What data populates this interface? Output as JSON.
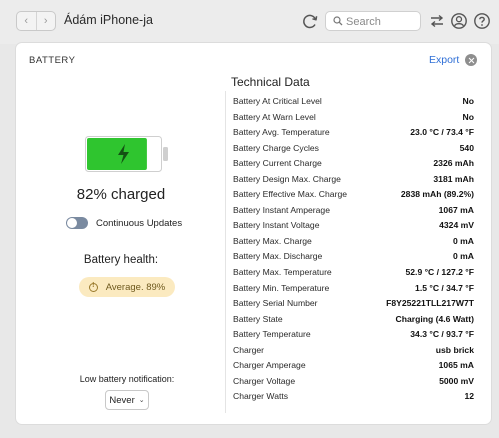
{
  "toolbar": {
    "device_name": "Ádám iPhone-ja",
    "back_glyph": "‹",
    "forward_glyph": "›",
    "search_placeholder": "Search",
    "icons": [
      "refresh-icon",
      "search-icon",
      "transfer-icon",
      "account-icon",
      "help-icon"
    ]
  },
  "panel": {
    "title": "BATTERY",
    "export_label": "Export"
  },
  "battery": {
    "charge_fraction": 0.82,
    "charged_text": "82% charged",
    "continuous_updates_label": "Continuous Updates",
    "continuous_updates_on": false,
    "health_title": "Battery health:",
    "health_value": "Average. 89%",
    "low_battery_label": "Low battery notification:",
    "low_battery_value": "Never",
    "colors": {
      "fill": "#2fc52f",
      "badge_bg": "#fbeac0",
      "accent": "#2f6fd6"
    }
  },
  "technical": {
    "title": "Technical Data",
    "rows": [
      {
        "label": "Battery At Critical Level",
        "value": "No"
      },
      {
        "label": "Battery At Warn Level",
        "value": "No"
      },
      {
        "label": "Battery Avg. Temperature",
        "value": "23.0 °C / 73.4 °F"
      },
      {
        "label": "Battery Charge Cycles",
        "value": "540"
      },
      {
        "label": "Battery Current Charge",
        "value": "2326 mAh"
      },
      {
        "label": "Battery Design Max. Charge",
        "value": "3181 mAh"
      },
      {
        "label": "Battery Effective Max. Charge",
        "value": "2838 mAh (89.2%)"
      },
      {
        "label": "Battery Instant Amperage",
        "value": "1067 mA"
      },
      {
        "label": "Battery Instant Voltage",
        "value": "4324 mV"
      },
      {
        "label": "Battery Max. Charge",
        "value": "0 mA"
      },
      {
        "label": "Battery Max. Discharge",
        "value": "0 mA"
      },
      {
        "label": "Battery Max. Temperature",
        "value": "52.9 °C / 127.2 °F"
      },
      {
        "label": "Battery Min. Temperature",
        "value": "1.5 °C / 34.7 °F"
      },
      {
        "label": "Battery Serial Number",
        "value": "F8Y25221TLL217W7T"
      },
      {
        "label": "Battery State",
        "value": "Charging (4.6 Watt)"
      },
      {
        "label": "Battery Temperature",
        "value": "34.3 °C / 93.7 °F"
      },
      {
        "label": "Charger",
        "value": "usb brick"
      },
      {
        "label": "Charger Amperage",
        "value": "1065 mA"
      },
      {
        "label": "Charger Voltage",
        "value": "5000 mV"
      },
      {
        "label": "Charger Watts",
        "value": "12"
      }
    ]
  }
}
